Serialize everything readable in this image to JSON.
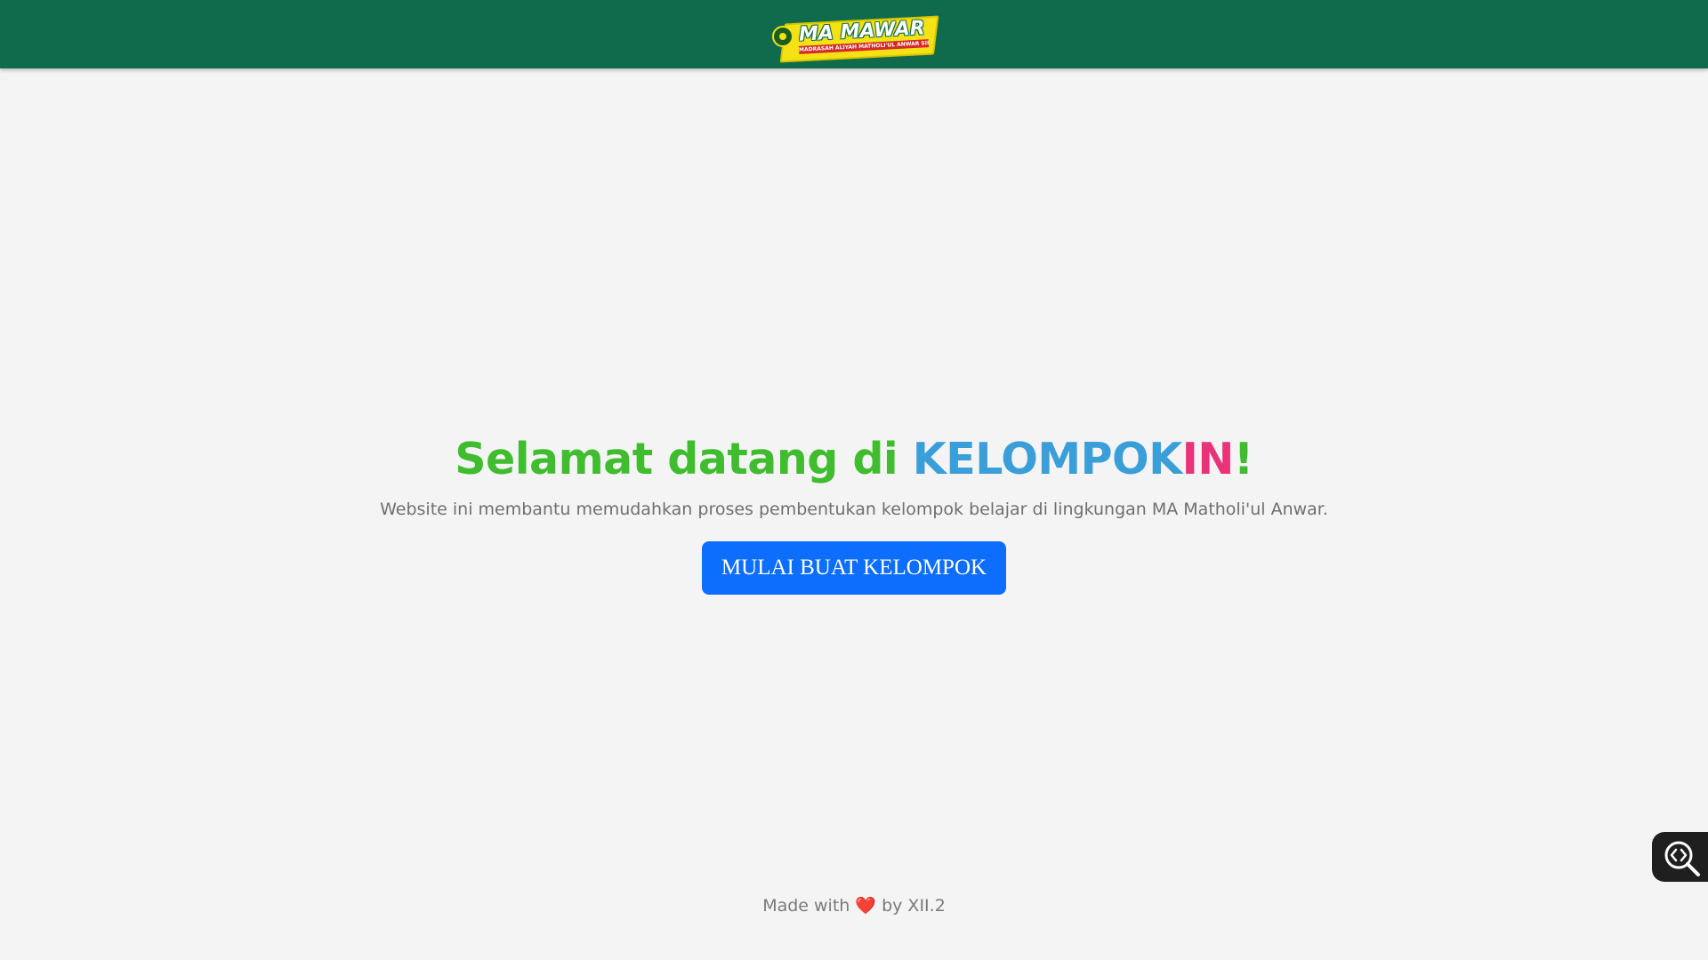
{
  "header": {
    "logo": {
      "title": "MA MAWAR",
      "subtitle": "MADRASAH ALIYAH MATHOLI'UL ANWAR SIMO"
    }
  },
  "hero": {
    "title_part1": "Selamat datang di ",
    "title_part2": "KELOMPOK",
    "title_part3": "IN",
    "title_part4": "!",
    "subtitle": "Website ini membantu memudahkan proses pembentukan kelompok belajar di lingkungan MA Matholi'ul Anwar.",
    "cta_label": "MULAI BUAT KELOMPOK"
  },
  "footer": {
    "prefix": "Made with ",
    "heart": "❤️",
    "suffix": " by XII.2"
  },
  "floating_tool": {
    "icon": "code-search-icon"
  },
  "colors": {
    "navbar": "#0f6b4c",
    "title_green": "#3fbd2e",
    "title_blue": "#3a9fd8",
    "title_pink": "#e8337a",
    "button": "#0d6efd",
    "background": "#f4f4f4"
  }
}
